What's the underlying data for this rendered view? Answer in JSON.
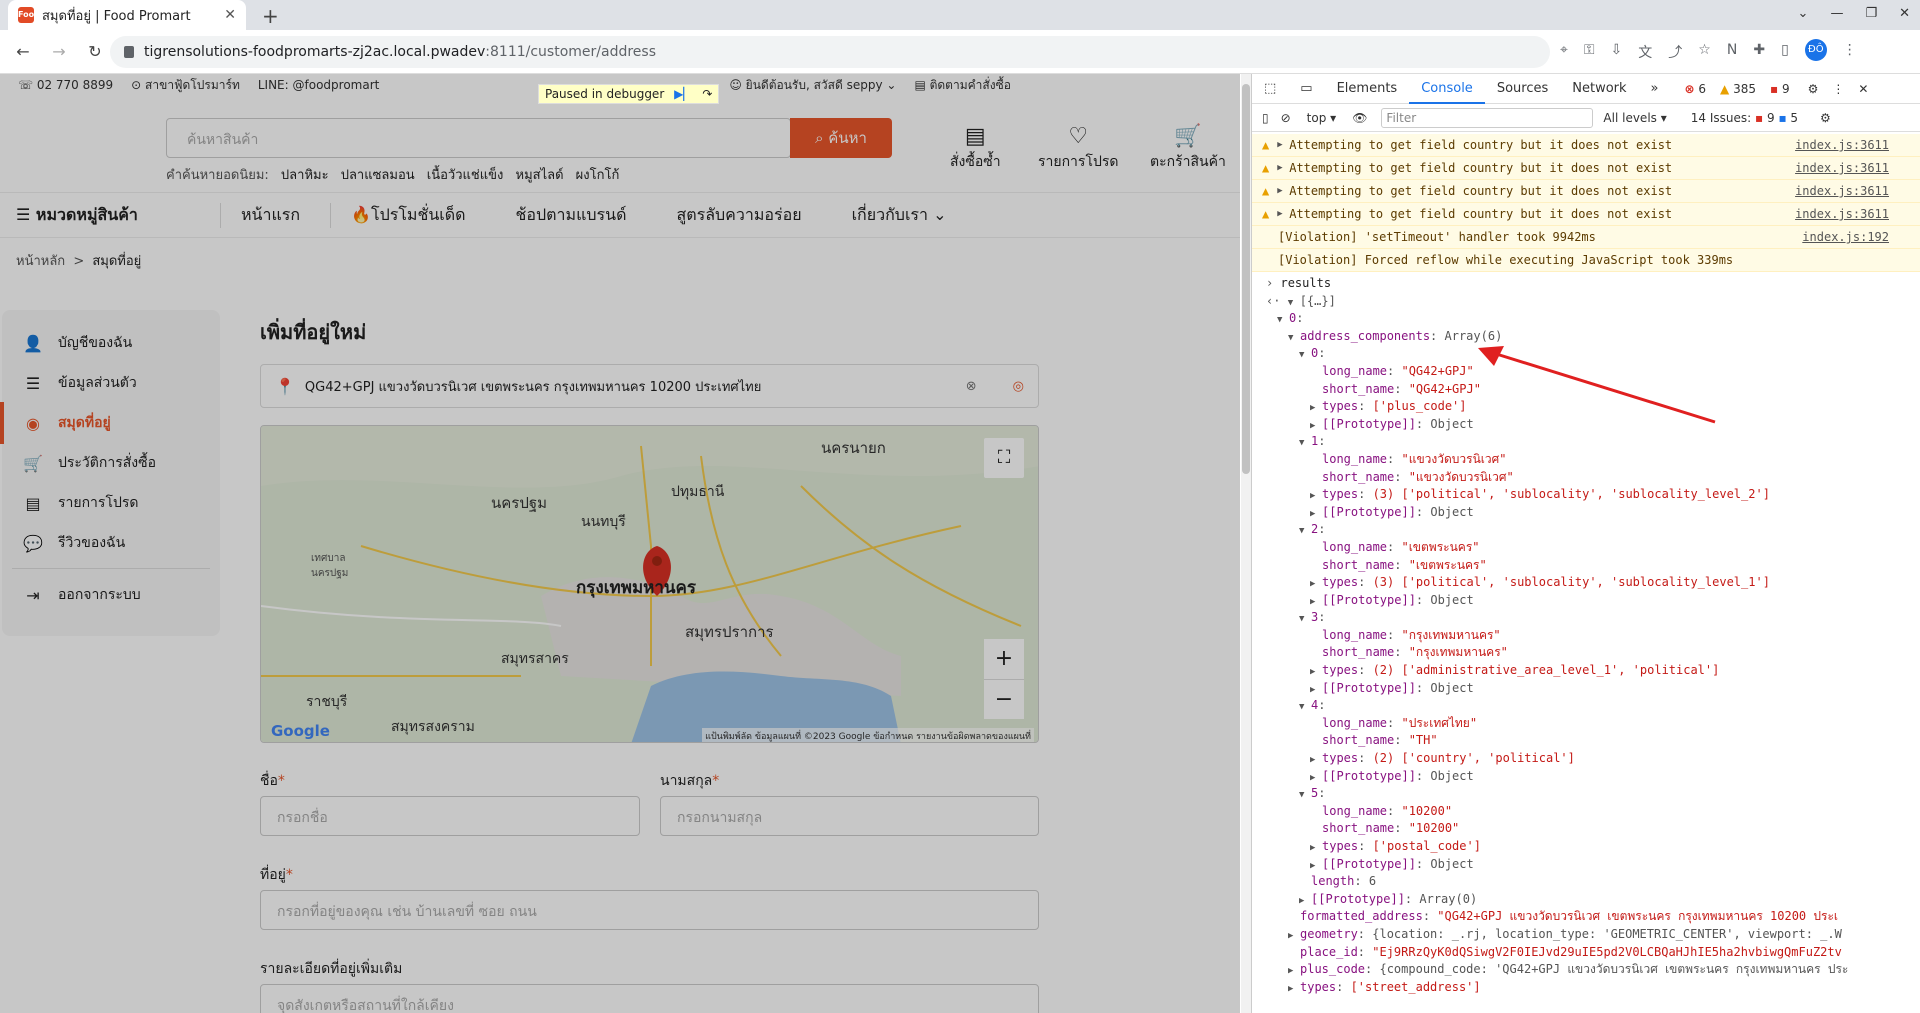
{
  "browser": {
    "tab_title": "สมุดที่อยู่ | Food Promart",
    "tab_favicon": "Food Pro",
    "url_host": "tigrensolutions-foodpromarts-zj2ac.local.pwadev",
    "url_path": ":8111/customer/address"
  },
  "site": {
    "topstrip": {
      "phone": "02 770 8899",
      "branch": "สาขาฟู้ดโปรมาร์ท",
      "line": "LINE: @foodpromart",
      "welcome": "ยินดีต้อนรับ, สวัสดี seppy",
      "track": "ติดตามคำสั่งซื้อ"
    },
    "debugger": "Paused in debugger",
    "search": {
      "placeholder": "ค้นหาสินค้า",
      "button": "ค้นหา",
      "popular_label": "คำค้นหายอดนิยม:",
      "popular": [
        "ปลาหิมะ",
        "ปลาแซลมอน",
        "เนื้อวัวแช่แข็ง",
        "หมูสไลด์",
        "ผงโกโก้"
      ]
    },
    "header_buttons": [
      "สั่งซื้อซ้ำ",
      "รายการโปรด",
      "ตะกร้าสินค้า"
    ],
    "nav": {
      "menu": "หมวดหมู่สินค้า",
      "items": [
        "หน้าแรก",
        "🔥โปรโมชั่นเด็ด",
        "ช้อปตามแบรนด์",
        "สูตรลับความอร่อย",
        "เกี่ยวกับเรา ⌄"
      ]
    },
    "breadcrumb": {
      "home": "หน้าหลัก",
      "sep": ">",
      "current": "สมุดที่อยู่"
    },
    "sidebar": [
      {
        "icon": "user-icon",
        "label": "บัญชีของฉัน"
      },
      {
        "icon": "profile-list-icon",
        "label": "ข้อมูลส่วนตัว"
      },
      {
        "icon": "location-icon",
        "label": "สมุดที่อยู่"
      },
      {
        "icon": "order-history-icon",
        "label": "ประวัติการสั่งซื้อ"
      },
      {
        "icon": "wishlist-icon",
        "label": "รายการโปรด"
      },
      {
        "icon": "review-icon",
        "label": "รีวิวของฉัน"
      },
      {
        "icon": "logout-icon",
        "label": "ออกจากระบบ"
      }
    ],
    "form": {
      "title": "เพิ่มที่อยู่ใหม่",
      "address_search": "QG42+GPJ แขวงวัดบวรนิเวศ เขตพระนคร กรุงเทพมหานคร 10200 ประเทศไทย",
      "first_name_label": "ชื่อ",
      "first_name_placeholder": "กรอกชื่อ",
      "last_name_label": "นามสกุล",
      "last_name_placeholder": "กรอกนามสกุล",
      "address_label": "ที่อยู่",
      "address_placeholder": "กรอกที่อยู่ของคุณ เช่น บ้านเลขที่ ซอย ถนน",
      "extra_label": "รายละเอียดที่อยู่เพิ่มเติม",
      "extra_placeholder": "จุดสังเกตหรือสถานที่ใกล้เคียง",
      "required": "*"
    },
    "map": {
      "labels": [
        "นครนายก",
        "นครปฐม",
        "ปทุมธานี",
        "นนทบุรี",
        "กรุงเทพมหานคร",
        "สมุทรสาคร",
        "สมุทรปราการ",
        "ราชบุรี",
        "สมุทรสงคราม",
        "เทศบาลนครปฐม"
      ],
      "attribution": "แป้นพิมพ์ลัด   ข้อมูลแผนที่ ©2023 Google   ข้อกำหนด   รายงานข้อผิดพลาดของแผนที่",
      "google": "Google",
      "zoom_in": "+",
      "zoom_out": "−"
    }
  },
  "devtools": {
    "tabs": [
      "Elements",
      "Console",
      "Sources",
      "Network"
    ],
    "errors": "6",
    "warnings": "385",
    "info": "9",
    "context": "top",
    "filter_placeholder": "Filter",
    "levels": "All levels",
    "issues_label": "14 Issues:",
    "issues_err": "9",
    "issues_info": "5",
    "warnings_list": [
      {
        "text": "Attempting to get field country but it does not exist",
        "src": "index.js:3611"
      },
      {
        "text": "Attempting to get field country but it does not exist",
        "src": "index.js:3611"
      },
      {
        "text": "Attempting to get field country but it does not exist",
        "src": "index.js:3611"
      },
      {
        "text": "Attempting to get field country but it does not exist",
        "src": "index.js:3611"
      }
    ],
    "violations": [
      {
        "text": "[Violation] 'setTimeout' handler took 9942ms",
        "src": "index.js:192"
      },
      {
        "text": "[Violation] Forced reflow while executing JavaScript took 339ms",
        "src": ""
      }
    ],
    "results_cmd": "results",
    "tree": [
      {
        "ind": 0,
        "tri": "▼",
        "key": "",
        "val": "[{…}]",
        "cls": "m",
        "prefix": "‹·"
      },
      {
        "ind": 1,
        "tri": "▼",
        "key": "0",
        "val": "",
        "cls": "m"
      },
      {
        "ind": 2,
        "tri": "▼",
        "key": "address_components",
        "val": "Array(6)",
        "cls": "m"
      },
      {
        "ind": 3,
        "tri": "▼",
        "key": "0",
        "val": "",
        "cls": "m"
      },
      {
        "ind": 4,
        "tri": "",
        "key": "long_name",
        "val": "\"QG42+GPJ\"",
        "cls": "s"
      },
      {
        "ind": 4,
        "tri": "",
        "key": "short_name",
        "val": "\"QG42+GPJ\"",
        "cls": "s"
      },
      {
        "ind": 4,
        "tri": "▶",
        "key": "types",
        "val": "['plus_code']",
        "cls": "s"
      },
      {
        "ind": 4,
        "tri": "▶",
        "key": "[[Prototype]]",
        "val": "Object",
        "cls": "m"
      },
      {
        "ind": 3,
        "tri": "▼",
        "key": "1",
        "val": "",
        "cls": "m"
      },
      {
        "ind": 4,
        "tri": "",
        "key": "long_name",
        "val": "\"แขวงวัดบวรนิเวศ\"",
        "cls": "s"
      },
      {
        "ind": 4,
        "tri": "",
        "key": "short_name",
        "val": "\"แขวงวัดบวรนิเวศ\"",
        "cls": "s"
      },
      {
        "ind": 4,
        "tri": "▶",
        "key": "types",
        "val": "(3) ['political', 'sublocality', 'sublocality_level_2']",
        "cls": "s"
      },
      {
        "ind": 4,
        "tri": "▶",
        "key": "[[Prototype]]",
        "val": "Object",
        "cls": "m"
      },
      {
        "ind": 3,
        "tri": "▼",
        "key": "2",
        "val": "",
        "cls": "m"
      },
      {
        "ind": 4,
        "tri": "",
        "key": "long_name",
        "val": "\"เขตพระนคร\"",
        "cls": "s"
      },
      {
        "ind": 4,
        "tri": "",
        "key": "short_name",
        "val": "\"เขตพระนคร\"",
        "cls": "s"
      },
      {
        "ind": 4,
        "tri": "▶",
        "key": "types",
        "val": "(3) ['political', 'sublocality', 'sublocality_level_1']",
        "cls": "s"
      },
      {
        "ind": 4,
        "tri": "▶",
        "key": "[[Prototype]]",
        "val": "Object",
        "cls": "m"
      },
      {
        "ind": 3,
        "tri": "▼",
        "key": "3",
        "val": "",
        "cls": "m"
      },
      {
        "ind": 4,
        "tri": "",
        "key": "long_name",
        "val": "\"กรุงเทพมหานคร\"",
        "cls": "s"
      },
      {
        "ind": 4,
        "tri": "",
        "key": "short_name",
        "val": "\"กรุงเทพมหานคร\"",
        "cls": "s"
      },
      {
        "ind": 4,
        "tri": "▶",
        "key": "types",
        "val": "(2) ['administrative_area_level_1', 'political']",
        "cls": "s"
      },
      {
        "ind": 4,
        "tri": "▶",
        "key": "[[Prototype]]",
        "val": "Object",
        "cls": "m"
      },
      {
        "ind": 3,
        "tri": "▼",
        "key": "4",
        "val": "",
        "cls": "m"
      },
      {
        "ind": 4,
        "tri": "",
        "key": "long_name",
        "val": "\"ประเทศไทย\"",
        "cls": "s"
      },
      {
        "ind": 4,
        "tri": "",
        "key": "short_name",
        "val": "\"TH\"",
        "cls": "s"
      },
      {
        "ind": 4,
        "tri": "▶",
        "key": "types",
        "val": "(2) ['country', 'political']",
        "cls": "s"
      },
      {
        "ind": 4,
        "tri": "▶",
        "key": "[[Prototype]]",
        "val": "Object",
        "cls": "m"
      },
      {
        "ind": 3,
        "tri": "▼",
        "key": "5",
        "val": "",
        "cls": "m"
      },
      {
        "ind": 4,
        "tri": "",
        "key": "long_name",
        "val": "\"10200\"",
        "cls": "s"
      },
      {
        "ind": 4,
        "tri": "",
        "key": "short_name",
        "val": "\"10200\"",
        "cls": "s"
      },
      {
        "ind": 4,
        "tri": "▶",
        "key": "types",
        "val": "['postal_code']",
        "cls": "s"
      },
      {
        "ind": 4,
        "tri": "▶",
        "key": "[[Prototype]]",
        "val": "Object",
        "cls": "m"
      },
      {
        "ind": 3,
        "tri": "",
        "key": "length",
        "val": "6",
        "cls": "m"
      },
      {
        "ind": 3,
        "tri": "▶",
        "key": "[[Prototype]]",
        "val": "Array(0)",
        "cls": "m"
      },
      {
        "ind": 2,
        "tri": "",
        "key": "formatted_address",
        "val": "\"QG42+GPJ แขวงวัดบวรนิเวศ เขตพระนคร กรุงเทพมหานคร 10200 ประเ",
        "cls": "s"
      },
      {
        "ind": 2,
        "tri": "▶",
        "key": "geometry",
        "val": "{location: _.rj, location_type: 'GEOMETRIC_CENTER', viewport: _.W",
        "cls": "m"
      },
      {
        "ind": 2,
        "tri": "",
        "key": "place_id",
        "val": "\"Ej9RRzQyK0dQSiwgV2F0IEJvd29uIE5pd2V0LCBQaHJhIE5ha2hvbiwgQmFuZ2tv",
        "cls": "s"
      },
      {
        "ind": 2,
        "tri": "▶",
        "key": "plus_code",
        "val": "{compound_code: 'QG42+GPJ แขวงวัดบวรนิเวศ เขตพระนคร กรุงเทพมหานคร ประ",
        "cls": "m"
      },
      {
        "ind": 2,
        "tri": "▶",
        "key": "types",
        "val": "['street_address']",
        "cls": "s"
      }
    ]
  }
}
